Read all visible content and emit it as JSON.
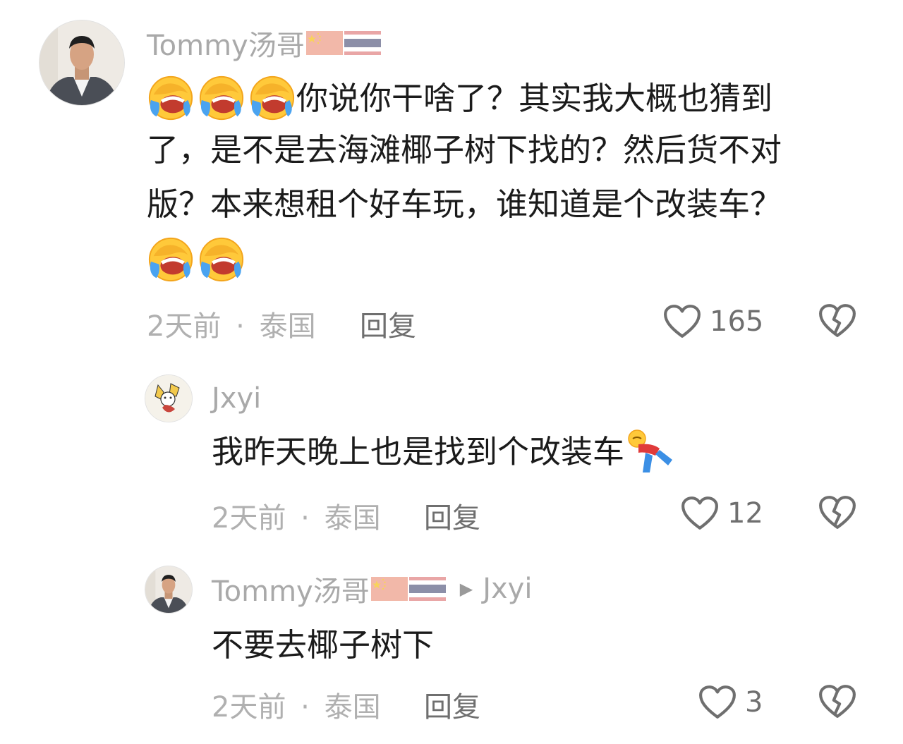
{
  "comments": [
    {
      "username": "Tommy汤哥",
      "flags": [
        "cn-flag",
        "th-flag"
      ],
      "text_line1": "你说你干啥了？其实我大概也猜到",
      "text_line2": "了，是不是去海滩椰子树下找的？然后货不对",
      "text_line3": "版？本来想租个好车玩，谁知道是个改装车？",
      "time": "2天前",
      "separator": "·",
      "location": "泰国",
      "reply_label": "回复",
      "likes": "165",
      "emojis": [
        "crying-laughing-emoji",
        "crying-laughing-emoji",
        "crying-laughing-emoji",
        "crying-laughing-emoji",
        "crying-laughing-emoji"
      ]
    },
    {
      "username": "Jxyi",
      "text": "我昨天晚上也是找到个改装车",
      "time": "2天前",
      "separator": "·",
      "location": "泰国",
      "reply_label": "回复",
      "likes": "12",
      "emojis": [
        "lying-down-emoji"
      ]
    },
    {
      "username": "Tommy汤哥",
      "flags": [
        "cn-flag",
        "th-flag"
      ],
      "reply_arrow": "▶",
      "reply_to": "Jxyi",
      "text": "不要去椰子树下",
      "time": "2天前",
      "separator": "·",
      "location": "泰国",
      "reply_label": "回复",
      "likes": "3"
    }
  ],
  "colors": {
    "username": "#a9a9a9",
    "text": "#1b1b1b",
    "meta": "#b0b0b0",
    "action": "#6f6f6f"
  },
  "icons": [
    "heart-outline-icon",
    "broken-heart-icon",
    "avatar-photo"
  ]
}
